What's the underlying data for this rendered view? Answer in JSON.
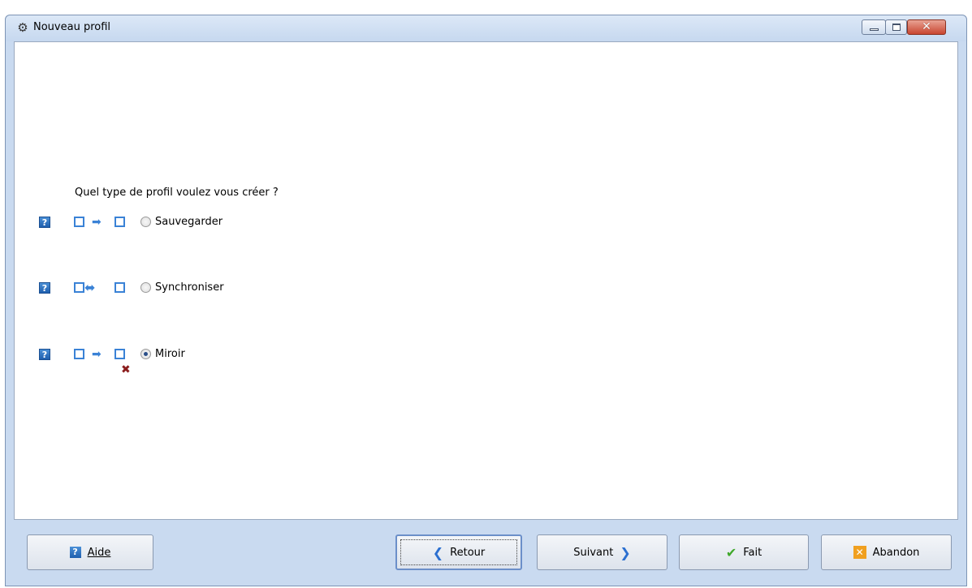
{
  "window": {
    "title": "Nouveau profil",
    "app_icon": "gear-icon"
  },
  "wizard": {
    "question": "Quel type de profil voulez vous créer ?",
    "options": [
      {
        "label": "Sauvegarder",
        "selected": false,
        "icon": "backup-arrow-icon"
      },
      {
        "label": "Synchroniser",
        "selected": false,
        "icon": "sync-double-arrow-icon"
      },
      {
        "label": "Miroir",
        "selected": true,
        "icon": "mirror-arrow-icon"
      }
    ]
  },
  "buttons": {
    "help": "Aide",
    "back": "Retour",
    "next": "Suivant",
    "done": "Fait",
    "cancel": "Abandon"
  },
  "colors": {
    "accent": "#3a82d6",
    "chrome": "#c9daf0",
    "close": "#c8452f"
  }
}
